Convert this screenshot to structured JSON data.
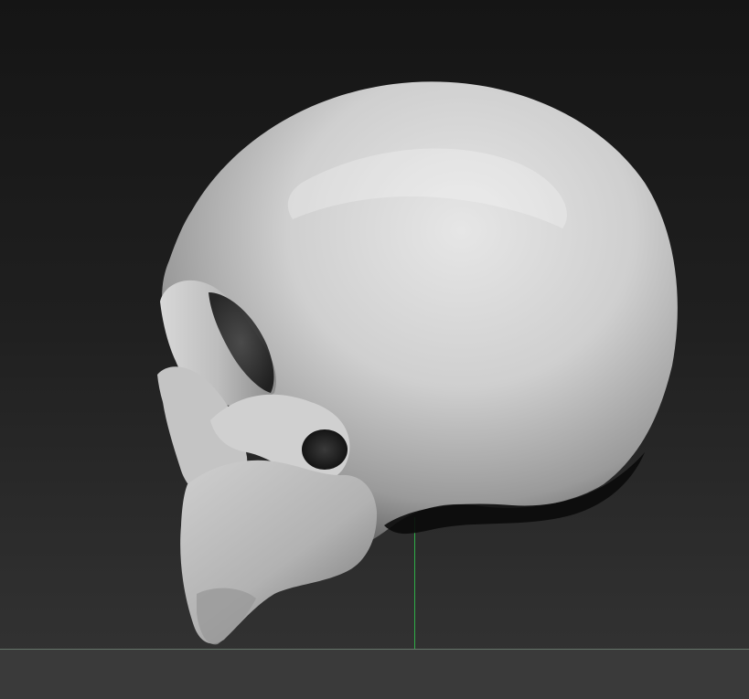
{
  "viewport": {
    "background_top": "#151515",
    "background_bottom": "#343434",
    "floor_color": "#3a3a3a",
    "axis_color": "#2fae48"
  },
  "model": {
    "icon": "skull-icon",
    "base_color": "#c9c9c9",
    "shadow_color": "#0a0a0a"
  }
}
